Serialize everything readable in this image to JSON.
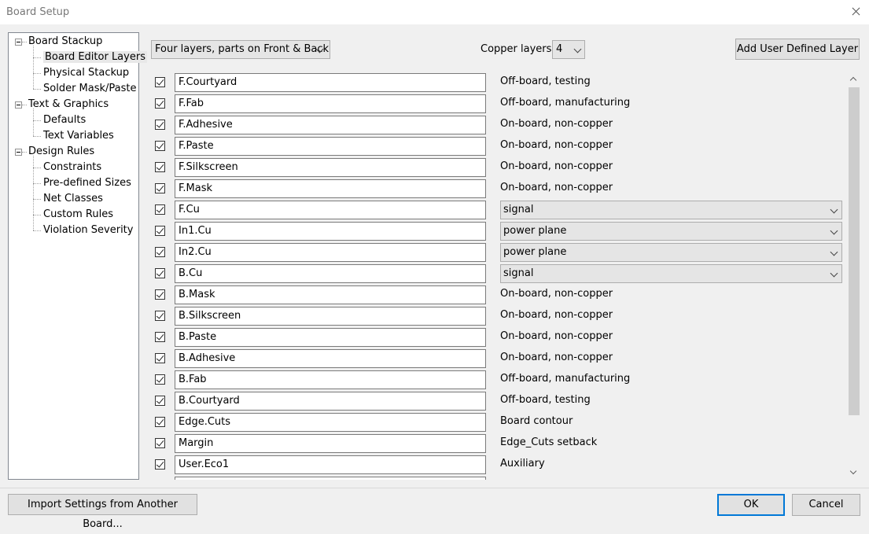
{
  "window": {
    "title": "Board Setup"
  },
  "tree": [
    {
      "label": "Board Stackup",
      "level": 0,
      "expanded": true
    },
    {
      "label": "Board Editor Layers",
      "level": 1,
      "selected": true
    },
    {
      "label": "Physical Stackup",
      "level": 1
    },
    {
      "label": "Solder Mask/Paste",
      "level": 1
    },
    {
      "label": "Text & Graphics",
      "level": 0,
      "expanded": true
    },
    {
      "label": "Defaults",
      "level": 1
    },
    {
      "label": "Text Variables",
      "level": 1
    },
    {
      "label": "Design Rules",
      "level": 0,
      "expanded": true
    },
    {
      "label": "Constraints",
      "level": 1
    },
    {
      "label": "Pre-defined Sizes",
      "level": 1
    },
    {
      "label": "Net Classes",
      "level": 1
    },
    {
      "label": "Custom Rules",
      "level": 1
    },
    {
      "label": "Violation Severity",
      "level": 1
    }
  ],
  "toolbar": {
    "preset_value": "Four layers, parts on Front & Back",
    "copper_label": "Copper layers:",
    "copper_value": "4",
    "add_layer_label": "Add User Defined Layer"
  },
  "layers": [
    {
      "name": "F.Courtyard",
      "desc": "Off-board, testing",
      "checked": true
    },
    {
      "name": "F.Fab",
      "desc": "Off-board, manufacturing",
      "checked": true
    },
    {
      "name": "F.Adhesive",
      "desc": "On-board, non-copper",
      "checked": true
    },
    {
      "name": "F.Paste",
      "desc": "On-board, non-copper",
      "checked": true
    },
    {
      "name": "F.Silkscreen",
      "desc": "On-board, non-copper",
      "checked": true
    },
    {
      "name": "F.Mask",
      "desc": "On-board, non-copper",
      "checked": true
    },
    {
      "name": "F.Cu",
      "type": "signal",
      "checked": true
    },
    {
      "name": "In1.Cu",
      "type": "power plane",
      "checked": true
    },
    {
      "name": "In2.Cu",
      "type": "power plane",
      "checked": true
    },
    {
      "name": "B.Cu",
      "type": "signal",
      "checked": true
    },
    {
      "name": "B.Mask",
      "desc": "On-board, non-copper",
      "checked": true
    },
    {
      "name": "B.Silkscreen",
      "desc": "On-board, non-copper",
      "checked": true
    },
    {
      "name": "B.Paste",
      "desc": "On-board, non-copper",
      "checked": true
    },
    {
      "name": "B.Adhesive",
      "desc": "On-board, non-copper",
      "checked": true
    },
    {
      "name": "B.Fab",
      "desc": "Off-board, manufacturing",
      "checked": true
    },
    {
      "name": "B.Courtyard",
      "desc": "Off-board, testing",
      "checked": true
    },
    {
      "name": "Edge.Cuts",
      "desc": "Board contour",
      "checked": true
    },
    {
      "name": "Margin",
      "desc": "Edge_Cuts setback",
      "checked": true
    },
    {
      "name": "User.Eco1",
      "desc": "Auxiliary",
      "checked": true
    },
    {
      "name": "",
      "desc": "",
      "checked": true
    }
  ],
  "footer": {
    "import_label": "Import Settings from Another Board...",
    "ok_label": "OK",
    "cancel_label": "Cancel"
  }
}
